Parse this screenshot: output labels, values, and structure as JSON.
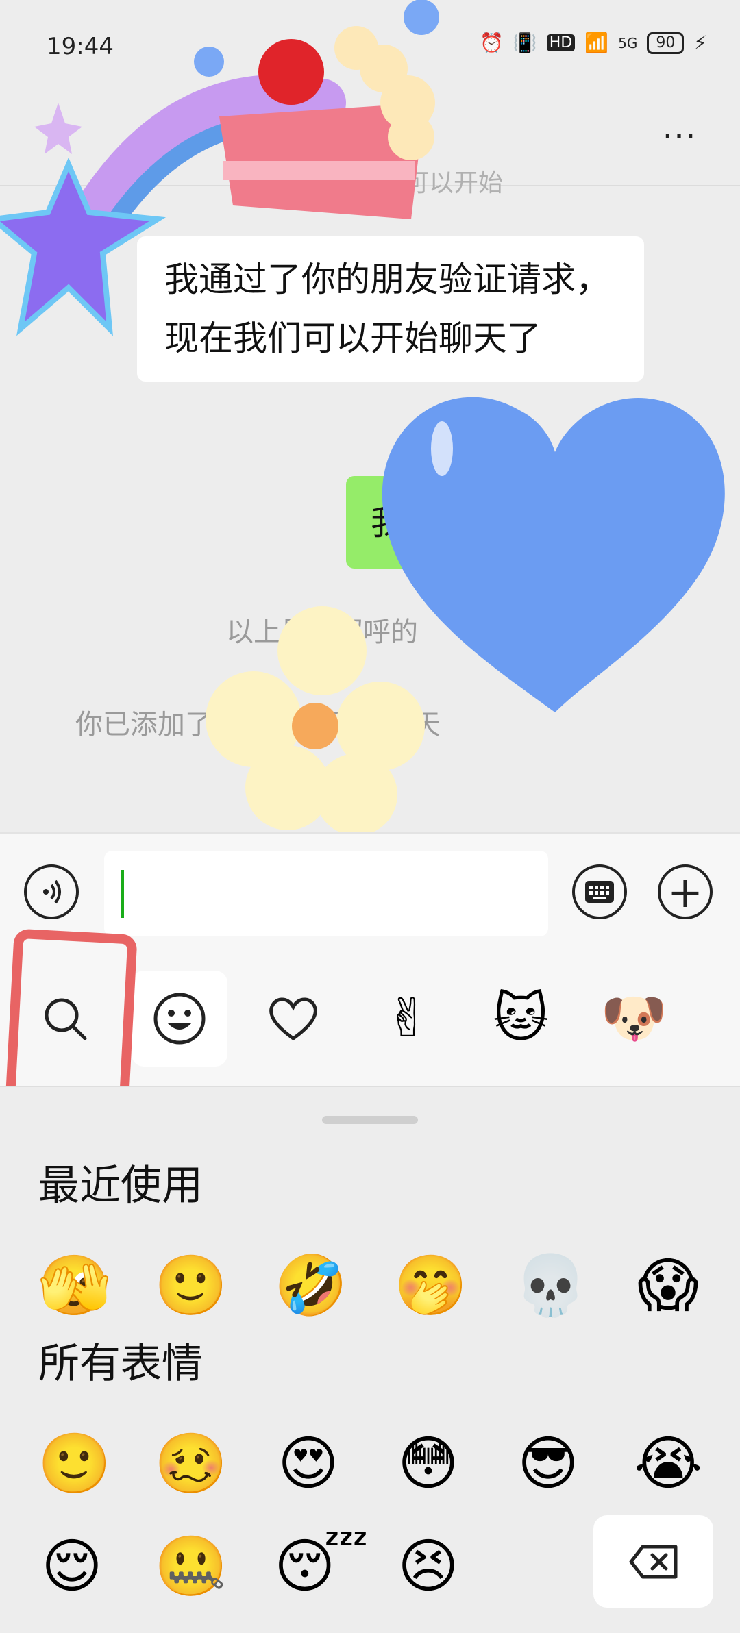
{
  "status_bar": {
    "time": "19:44",
    "network": "5G",
    "hd": "HD",
    "battery": "90"
  },
  "header": {
    "more_icon": "⋯",
    "partial_text": "可以开始"
  },
  "messages": {
    "incoming": "我通过了你的朋友验证请求，现在我们可以开始聊天了",
    "outgoing_partial": "我"
  },
  "system": {
    "line1": "以上是打招呼的",
    "line2": "你已添加了        现在可以开始聊天",
    "line2_end": "。"
  },
  "input_bar": {
    "voice_icon": "voice-icon",
    "keyboard_icon": "keyboard-icon",
    "plus_icon": "+"
  },
  "emoji_tabs": {
    "search": "search-icon",
    "emoji": "😀",
    "favorite": "♡",
    "sticker_gesture": "✌",
    "sticker1": "🐱",
    "sticker2": "🐶"
  },
  "panel": {
    "recent_title": "最近使用",
    "all_title": "所有表情",
    "recent": [
      "🫣",
      "🙂",
      "🤣",
      "🤭",
      "💀",
      "😱"
    ],
    "all_row1": [
      "🙂",
      "🥴",
      "😍",
      "😳",
      "😎",
      "😭"
    ],
    "all_row2": [
      "😌",
      "🤐",
      "😴",
      "😣"
    ]
  },
  "colors": {
    "green_bubble": "#95ec69",
    "highlight": "#e54a4a",
    "heart_blue": "#6b9cf2"
  }
}
